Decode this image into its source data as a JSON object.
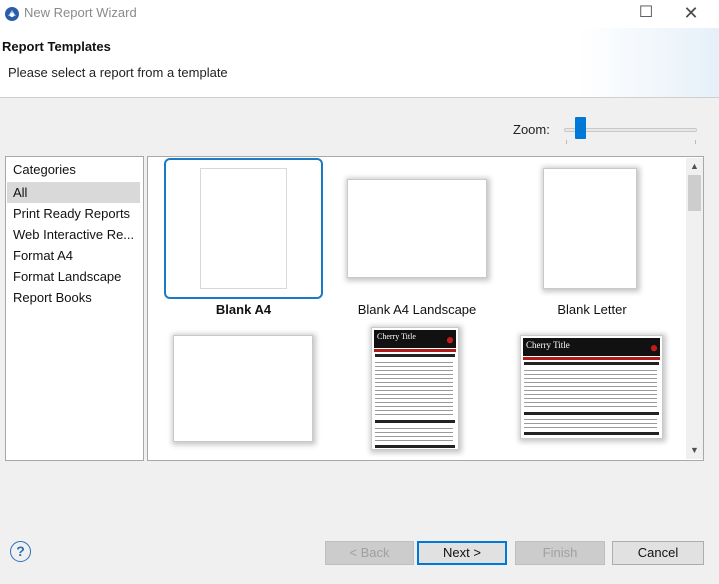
{
  "window": {
    "title": "New Report Wizard",
    "maximize_glyph": "☐",
    "close_glyph": "✕",
    "accent_color": "#1a7bc4"
  },
  "header": {
    "title": "Report Templates",
    "subtitle": "Please select a report from a template"
  },
  "zoom": {
    "label": "Zoom:",
    "level_fraction": 0.1
  },
  "categories": {
    "title": "Categories",
    "items": [
      {
        "label": "All",
        "selected": true
      },
      {
        "label": "Print Ready Reports",
        "selected": false
      },
      {
        "label": "Web Interactive Re...",
        "selected": false
      },
      {
        "label": "Format A4",
        "selected": false
      },
      {
        "label": "Format Landscape",
        "selected": false
      },
      {
        "label": "Report Books",
        "selected": false
      }
    ]
  },
  "templates": [
    {
      "label": "Blank A4",
      "selected": true,
      "kind": "blank-portrait"
    },
    {
      "label": "Blank A4 Landscape",
      "selected": false,
      "kind": "blank-landscape"
    },
    {
      "label": "Blank Letter",
      "selected": false,
      "kind": "blank-portrait"
    },
    {
      "label": "",
      "selected": false,
      "kind": "blank-landscape"
    },
    {
      "label": "",
      "selected": false,
      "kind": "cherry-portrait",
      "preview_title": "Cherry Title"
    },
    {
      "label": "",
      "selected": false,
      "kind": "cherry-landscape",
      "preview_title": "Cherry Title"
    }
  ],
  "buttons": {
    "help": "?",
    "back": "< Back",
    "next": "Next >",
    "finish": "Finish",
    "cancel": "Cancel"
  },
  "scrollbar": {
    "up_glyph": "▲",
    "down_glyph": "▼"
  }
}
